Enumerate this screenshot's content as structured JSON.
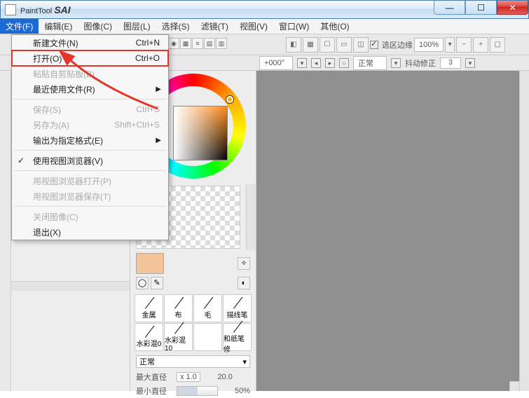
{
  "app": {
    "name_prefix": "PaintTool ",
    "name_bold": "SAI"
  },
  "menubar": {
    "file": "文件(F)",
    "edit": "编辑(E)",
    "image": "图像(C)",
    "layer": "图层(L)",
    "select": "选择(S)",
    "filter": "滤镜(T)",
    "view": "视图(V)",
    "window": "窗口(W)",
    "other": "其他(O)"
  },
  "file_menu": {
    "new": "新建文件(N)",
    "new_sc": "Ctrl+N",
    "open": "打开(O)",
    "open_sc": "Ctrl+O",
    "paste": "粘贴自剪贴板(B)",
    "recent": "最近使用文件(R)",
    "save": "保存(S)",
    "save_sc": "Ctrl+S",
    "saveas": "另存为(A)",
    "saveas_sc": "Shift+Ctrl+S",
    "export": "输出为指定格式(E)",
    "use_browser": "使用视图浏览器(V)",
    "browse_open": "用视图浏览器打开(P)",
    "browse_save": "用视图浏览器保存(T)",
    "close": "关闭图像(C)",
    "exit": "退出(X)"
  },
  "toolbar": {
    "sel_edge_label": "选区边缘",
    "zoom": "100%",
    "angle": "+000°",
    "blend": "正常",
    "stabilizer_label": "抖动修正",
    "stabilizer_value": "3"
  },
  "brushes": {
    "r0c0": "金属",
    "r0c1": "布",
    "r0c2": "毛",
    "r0c3": "描线笔",
    "r1c0": "水彩混0",
    "r1c1": "水彩混10",
    "r1c2": "",
    "r1c3": "和纸笔修"
  },
  "brush_mode": "正常",
  "params": {
    "max_size_label": "最大直径",
    "max_size_x": "x 1.0",
    "max_size_val": "20.0",
    "min_size_label": "最小直径",
    "min_size_pct": "50%"
  }
}
